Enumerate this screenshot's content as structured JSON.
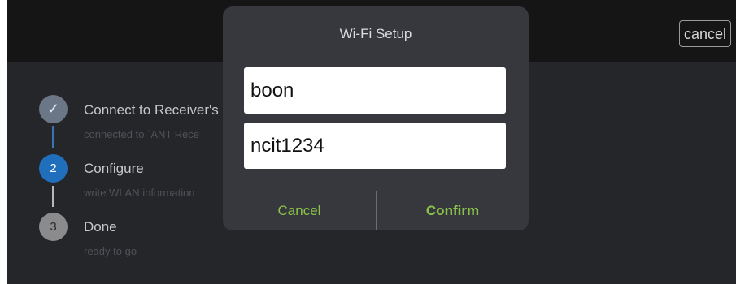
{
  "topbar": {
    "cancel_label": "cancel"
  },
  "steps": [
    {
      "number": "✓",
      "title": "Connect to Receiver's",
      "subtitle": "connected to `ANT Rece"
    },
    {
      "number": "2",
      "title": "Configure",
      "subtitle": "write WLAN information"
    },
    {
      "number": "3",
      "title": "Done",
      "subtitle": "ready to go"
    }
  ],
  "dialog": {
    "title": "Wi-Fi Setup",
    "ssid_value": "boon",
    "password_value": "ncit1234",
    "cancel_label": "Cancel",
    "confirm_label": "Confirm"
  },
  "colors": {
    "accent": "#8bc34a",
    "active_step": "#1f6fbd",
    "background": "#25262a"
  }
}
